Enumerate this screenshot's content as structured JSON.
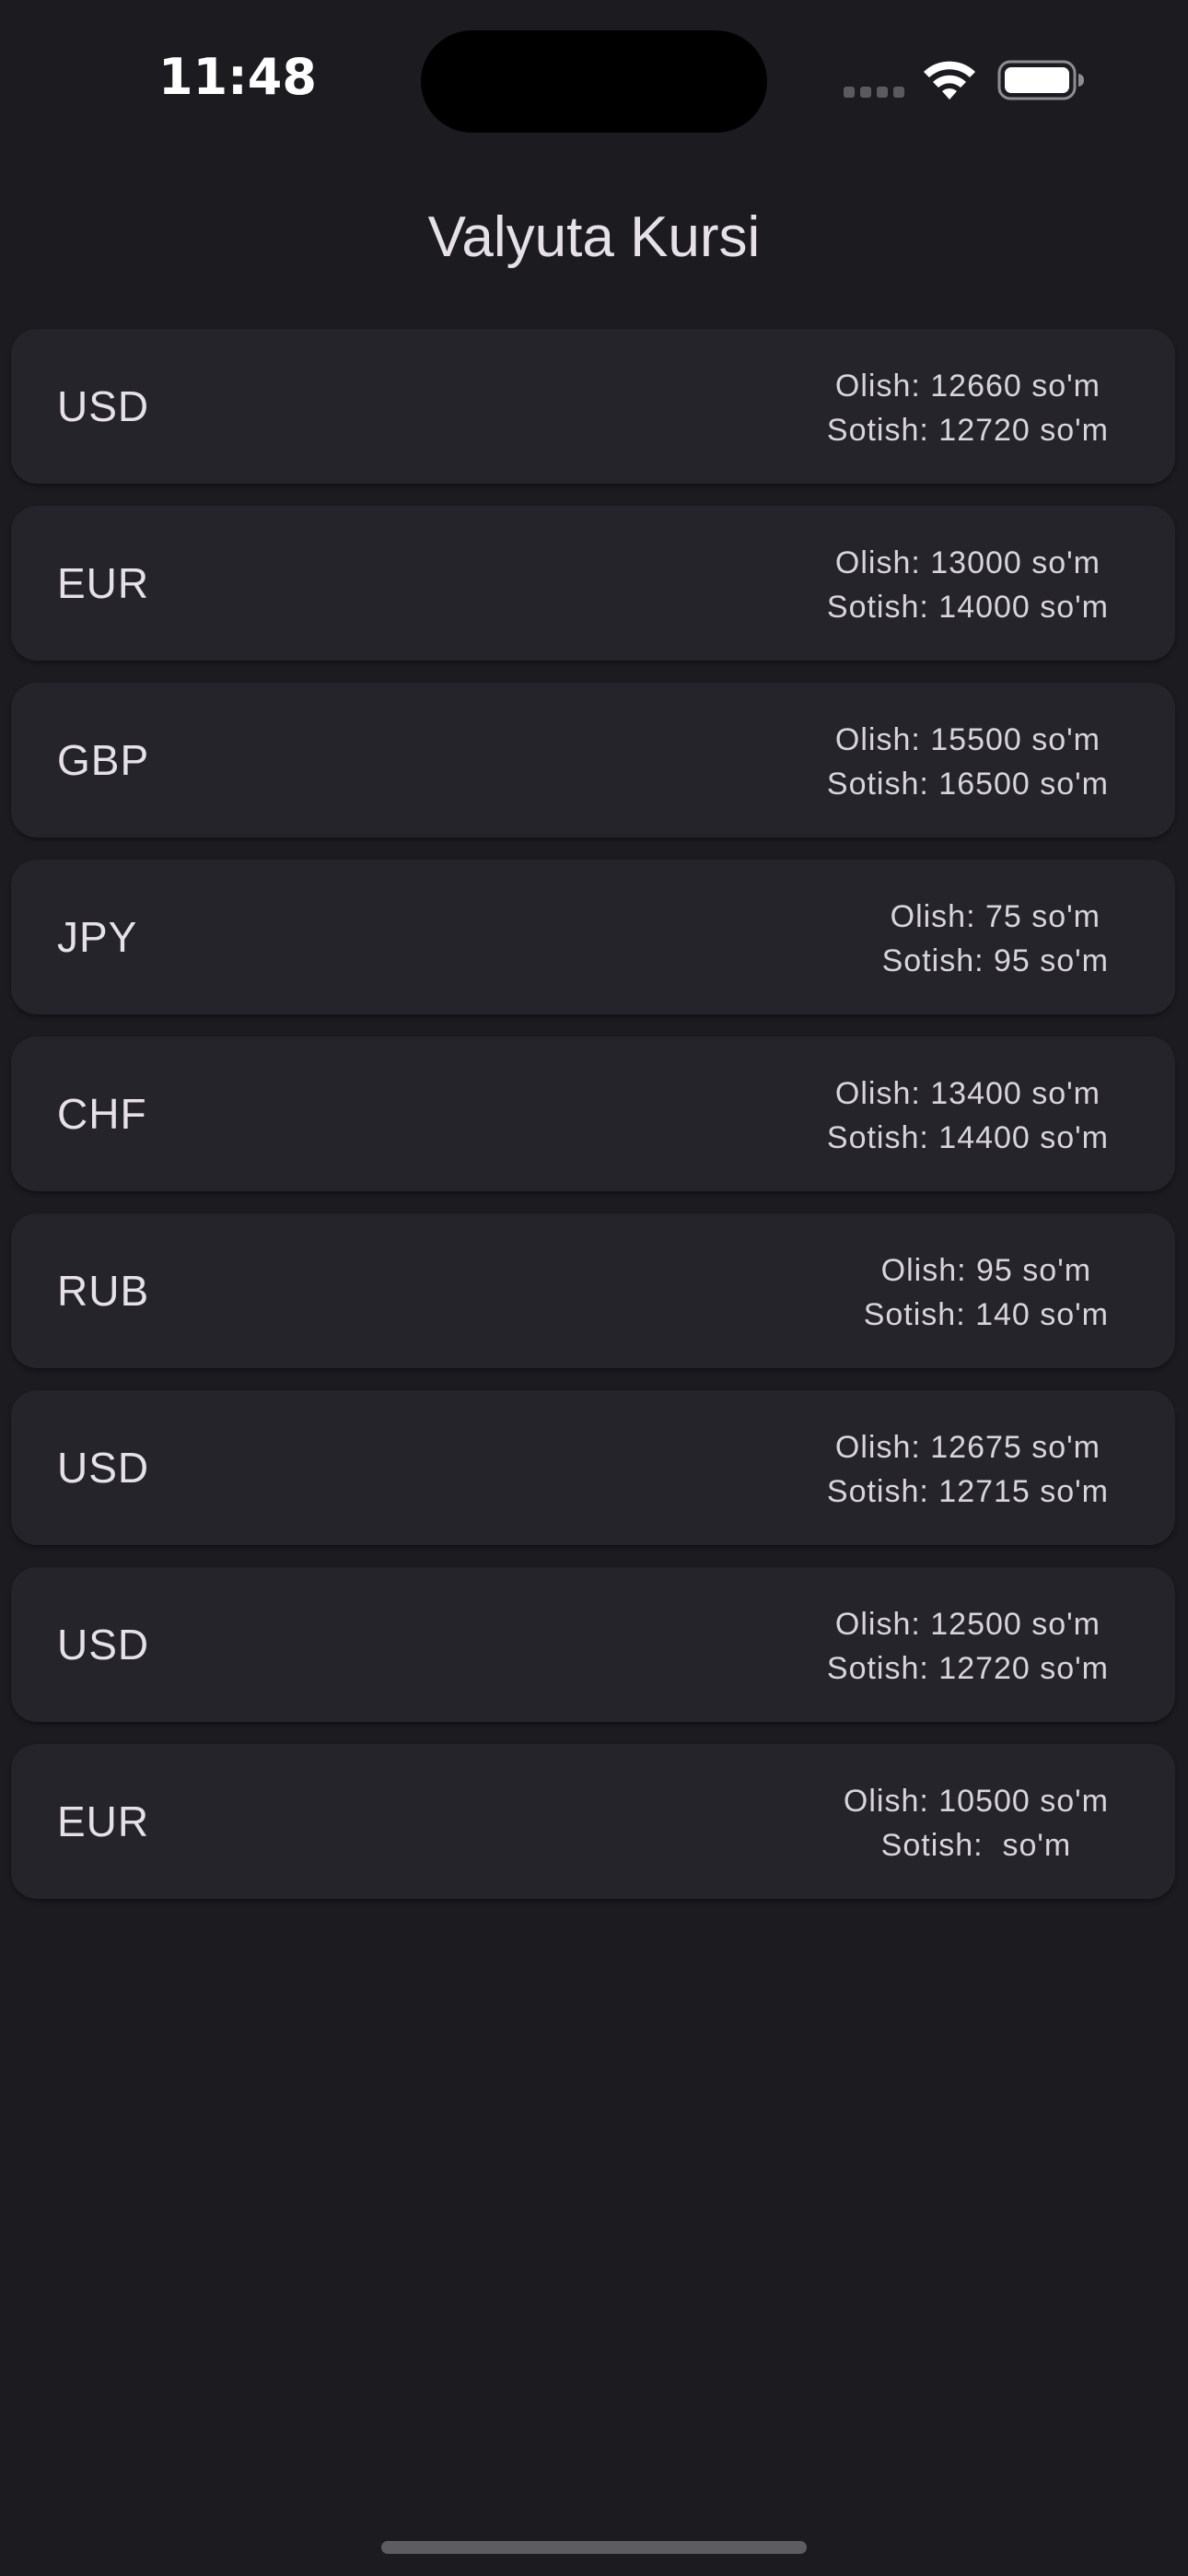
{
  "status_bar": {
    "time": "11:48",
    "icons": [
      "signal-icon",
      "wifi-icon",
      "battery-icon"
    ]
  },
  "app": {
    "title": "Valyuta Kursi"
  },
  "rates": [
    {
      "code": "USD",
      "buy": "Olish: 12660 so'm",
      "sell": "Sotish: 12720 so'm"
    },
    {
      "code": "EUR",
      "buy": "Olish: 13000 so'm",
      "sell": "Sotish: 14000 so'm"
    },
    {
      "code": "GBP",
      "buy": "Olish: 15500 so'm",
      "sell": "Sotish: 16500 so'm"
    },
    {
      "code": "JPY",
      "buy": "Olish: 75 so'm",
      "sell": "Sotish: 95 so'm"
    },
    {
      "code": "CHF",
      "buy": "Olish: 13400 so'm",
      "sell": "Sotish: 14400 so'm"
    },
    {
      "code": "RUB",
      "buy": "Olish: 95 so'm",
      "sell": "Sotish: 140 so'm"
    },
    {
      "code": "USD",
      "buy": "Olish: 12675 so'm",
      "sell": "Sotish: 12715 so'm"
    },
    {
      "code": "USD",
      "buy": "Olish: 12500 so'm",
      "sell": "Sotish: 12720 so'm"
    },
    {
      "code": "EUR",
      "buy": "Olish: 10500 so'm",
      "sell": "Sotish:  so'm"
    }
  ],
  "colors": {
    "background": "#1c1b20",
    "card": "#25242a",
    "text": "#e6e1e8"
  }
}
